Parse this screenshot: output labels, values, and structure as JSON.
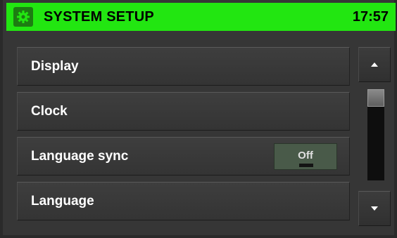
{
  "header": {
    "title": "SYSTEM SETUP",
    "time": "17:57",
    "icon": "gear-icon",
    "background_color": "#22e611"
  },
  "menu": {
    "items": [
      {
        "label": "Display"
      },
      {
        "label": "Clock"
      },
      {
        "label": "Language sync",
        "toggle_value": "Off"
      },
      {
        "label": "Language"
      }
    ]
  },
  "scrollbar": {
    "up_icon": "arrow-up-icon",
    "down_icon": "arrow-down-icon"
  }
}
